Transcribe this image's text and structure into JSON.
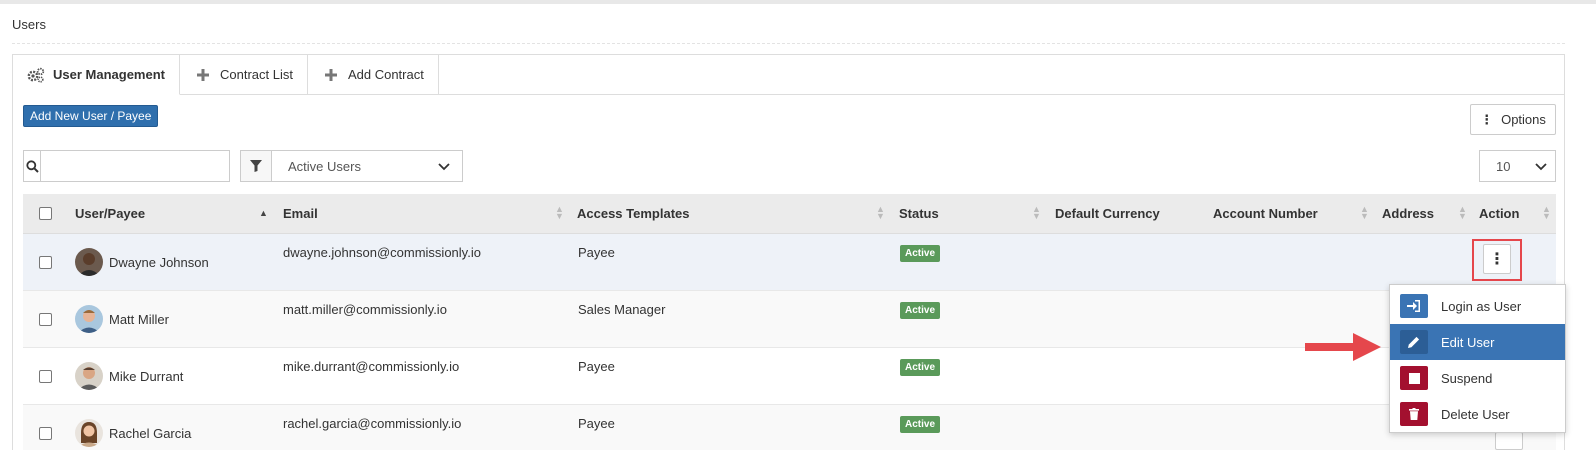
{
  "page": {
    "title": "Users"
  },
  "tabs": [
    {
      "label": "User Management",
      "icon": "gears-icon",
      "active": true
    },
    {
      "label": "Contract List",
      "icon": "plus-icon",
      "active": false
    },
    {
      "label": "Add Contract",
      "icon": "plus-icon",
      "active": false
    }
  ],
  "toolbar": {
    "add_label": "Add New User / Payee",
    "options_label": "Options",
    "search_placeholder": "",
    "search_value": "",
    "filter_value": "Active Users",
    "page_size": "10"
  },
  "table": {
    "columns": [
      "User/Payee",
      "Email",
      "Access Templates",
      "Status",
      "Default Currency",
      "Account Number",
      "Address",
      "Action"
    ],
    "rows": [
      {
        "name": "Dwayne Johnson",
        "email": "dwayne.johnson@commissionly.io",
        "template": "Payee",
        "status": "Active",
        "currency": "",
        "account": "",
        "address": ""
      },
      {
        "name": "Matt Miller",
        "email": "matt.miller@commissionly.io",
        "template": "Sales Manager",
        "status": "Active",
        "currency": "",
        "account": "",
        "address": ""
      },
      {
        "name": "Mike Durrant",
        "email": "mike.durrant@commissionly.io",
        "template": "Payee",
        "status": "Active",
        "currency": "",
        "account": "",
        "address": ""
      },
      {
        "name": "Rachel Garcia",
        "email": "rachel.garcia@commissionly.io",
        "template": "Payee",
        "status": "Active",
        "currency": "",
        "account": "",
        "address": ""
      }
    ]
  },
  "action_menu": {
    "items": [
      {
        "label": "Login as User",
        "icon": "sign-in-icon",
        "color": "#3a74b4"
      },
      {
        "label": "Edit User",
        "icon": "pencil-icon",
        "color": "#2c5e96"
      },
      {
        "label": "Suspend",
        "icon": "stop-icon",
        "color": "#a3102f"
      },
      {
        "label": "Delete User",
        "icon": "trash-icon",
        "color": "#a3102f"
      }
    ]
  },
  "colors": {
    "primary": "#2f6fad",
    "active_badge": "#5a9a5a",
    "danger": "#a3102f",
    "highlight": "#e5474c"
  }
}
